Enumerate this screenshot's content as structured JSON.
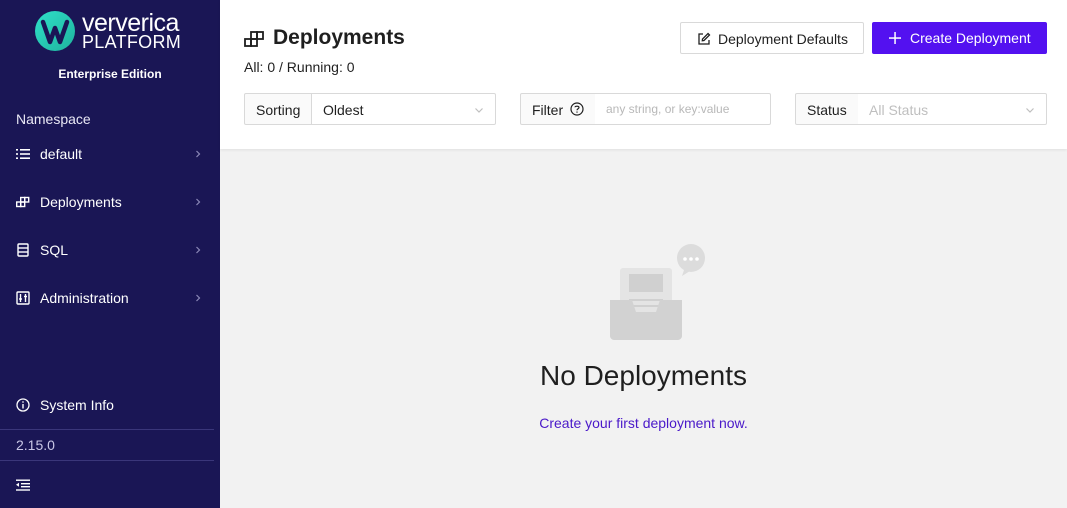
{
  "sidebar": {
    "logo_line1": "ververica",
    "logo_line2": "PLATFORM",
    "edition": "Enterprise Edition",
    "namespace_label": "Namespace",
    "items": [
      {
        "label": "default",
        "icon": "list-icon"
      },
      {
        "label": "Deployments",
        "icon": "deployments-icon"
      },
      {
        "label": "SQL",
        "icon": "sql-icon"
      },
      {
        "label": "Administration",
        "icon": "admin-icon"
      }
    ],
    "system_info": "System Info",
    "version": "2.15.0"
  },
  "header": {
    "title": "Deployments",
    "counts": "All: 0 / Running: 0",
    "defaults_button": "Deployment Defaults",
    "create_button": "Create Deployment"
  },
  "controls": {
    "sorting_label": "Sorting",
    "sorting_value": "Oldest",
    "filter_label": "Filter",
    "filter_placeholder": "any string, or key:value",
    "status_label": "Status",
    "status_placeholder": "All Status"
  },
  "empty": {
    "title": "No Deployments",
    "link": "Create your first deployment now."
  },
  "colors": {
    "sidebar_bg": "#1a1655",
    "accent": "#5311f0",
    "link": "#4a19c9"
  }
}
